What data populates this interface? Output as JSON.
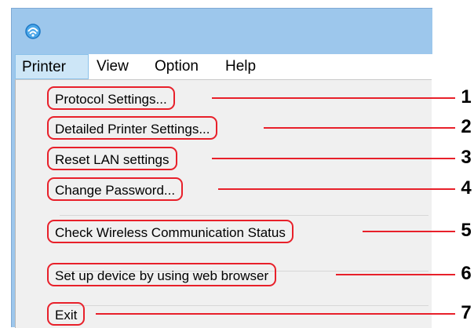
{
  "window": {
    "icon": "printer-network-icon"
  },
  "menubar": {
    "items": [
      {
        "label": "Printer",
        "active": true
      },
      {
        "label": "View"
      },
      {
        "label": "Option"
      },
      {
        "label": "Help"
      }
    ]
  },
  "menu": {
    "items": [
      {
        "label": "Protocol Settings..."
      },
      {
        "label": "Detailed Printer Settings..."
      },
      {
        "label": "Reset LAN settings"
      },
      {
        "label": "Change Password..."
      },
      {
        "label": "Check Wireless Communication Status"
      },
      {
        "label": "Set up device by using web browser"
      },
      {
        "label": "Exit"
      }
    ]
  },
  "callouts": [
    "1",
    "2",
    "3",
    "4",
    "5",
    "6",
    "7"
  ],
  "colors": {
    "highlight": "#e8202a",
    "menubar_active": "#cde6f7",
    "titlebar": "#9dc7ec",
    "menu_background": "#f0f0f0"
  }
}
